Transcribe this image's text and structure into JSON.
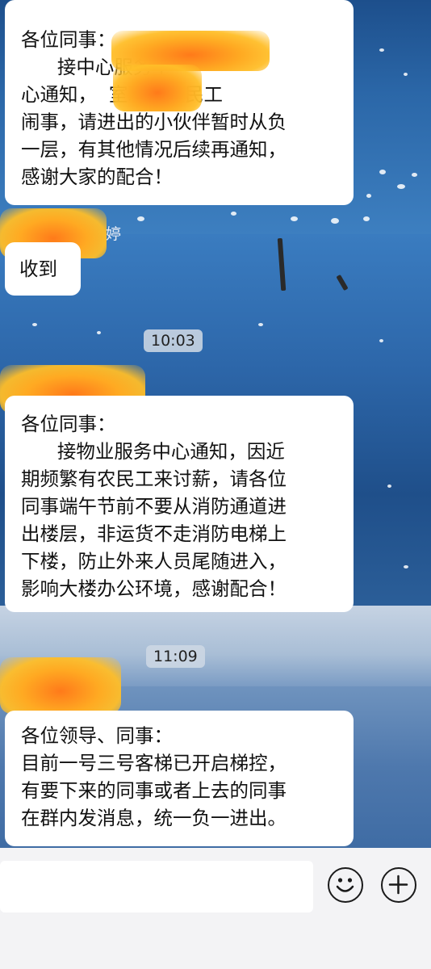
{
  "messages": [
    {
      "lines": [
        "各位同事：",
        "      接中心服务中",
        "心通知，  室现有农民工",
        "闹事，请进出的小伙伴暂时从负",
        "一层，有其他情况后续再通知，",
        "感谢大家的配合！"
      ]
    },
    {
      "sender_suffix": "婷",
      "lines": [
        "收到"
      ]
    },
    {
      "time": "10:03",
      "lines": [
        "各位同事：",
        "      接物业服务中心通知，因近",
        "期频繁有农民工来讨薪，请各位",
        "同事端午节前不要从消防通道进",
        "出楼层，非运货不走消防电梯上",
        "下楼，防止外来人员尾随进入，",
        "影响大楼办公环境，感谢配合！"
      ]
    },
    {
      "time": "11:09",
      "lines": [
        "各位领导、同事：",
        "目前一号三号客梯已开启梯控，",
        "有要下来的同事或者上去的同事",
        "在群内发消息，统一负一进出。"
      ]
    }
  ],
  "input_bar": {
    "emoji_icon": "smiley-icon",
    "add_icon": "plus-circle-icon"
  },
  "colors": {
    "bubble": "#ffffff",
    "redaction": "#ffa020",
    "water": "#2a5f9c"
  }
}
